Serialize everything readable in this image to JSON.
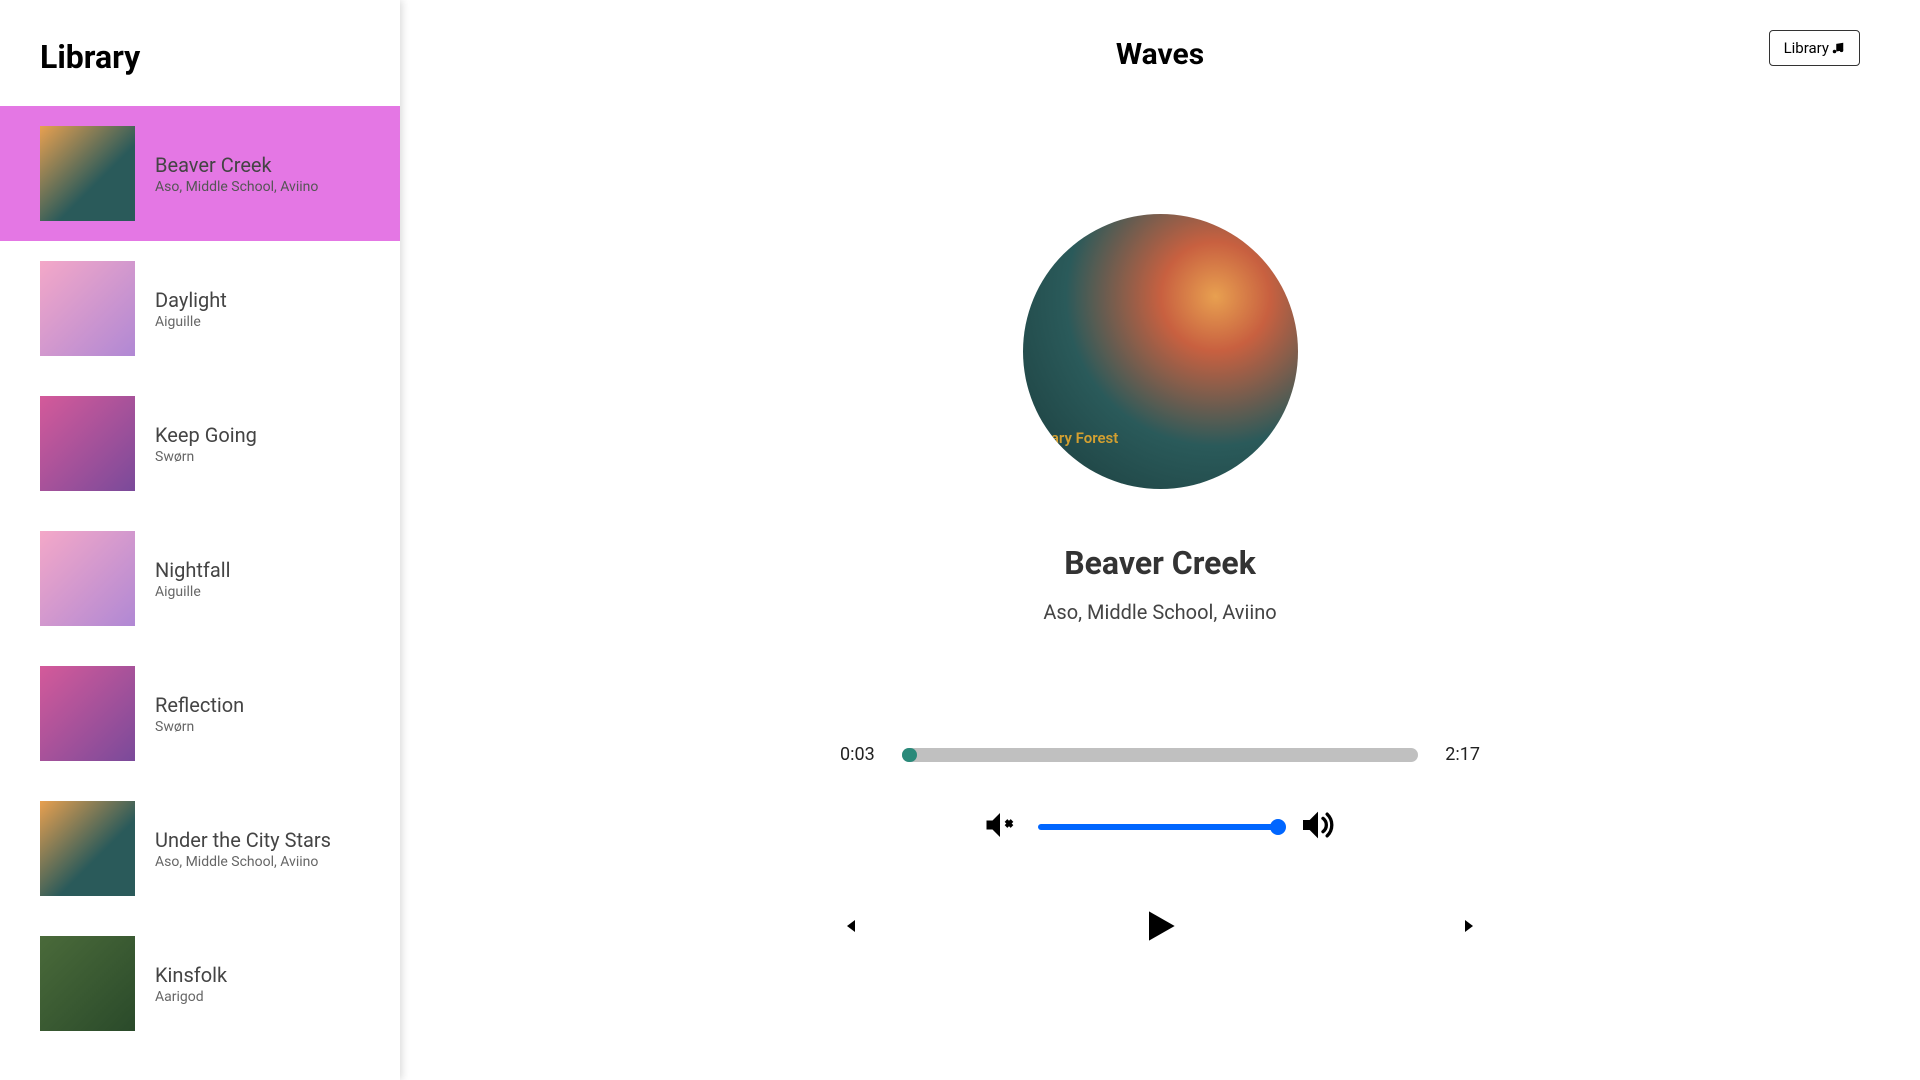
{
  "sidebar": {
    "title": "Library",
    "items": [
      {
        "title": "Beaver Creek",
        "artist": "Aso, Middle School, Aviino",
        "active": true,
        "art": "tealsunset"
      },
      {
        "title": "Daylight",
        "artist": "Aiguille",
        "active": false,
        "art": "pink"
      },
      {
        "title": "Keep Going",
        "artist": "Swørn",
        "active": false,
        "art": "magenta"
      },
      {
        "title": "Nightfall",
        "artist": "Aiguille",
        "active": false,
        "art": "pink"
      },
      {
        "title": "Reflection",
        "artist": "Swørn",
        "active": false,
        "art": "magenta"
      },
      {
        "title": "Under the City Stars",
        "artist": "Aso, Middle School, Aviino",
        "active": false,
        "art": "tealsunset"
      },
      {
        "title": "Kinsfolk",
        "artist": "Aarigod",
        "active": false,
        "art": "green"
      }
    ]
  },
  "header": {
    "app_title": "Waves",
    "library_btn": "Library"
  },
  "now_playing": {
    "title": "Beaver Creek",
    "artist": "Aso, Middle School, Aviino",
    "elapsed": "0:03",
    "duration": "2:17",
    "progress_pct": 3,
    "volume_pct": 100
  },
  "colors": {
    "accent_active": "#e477e4",
    "progress_fill": "#2a8a7a",
    "volume": "#0066ff"
  }
}
